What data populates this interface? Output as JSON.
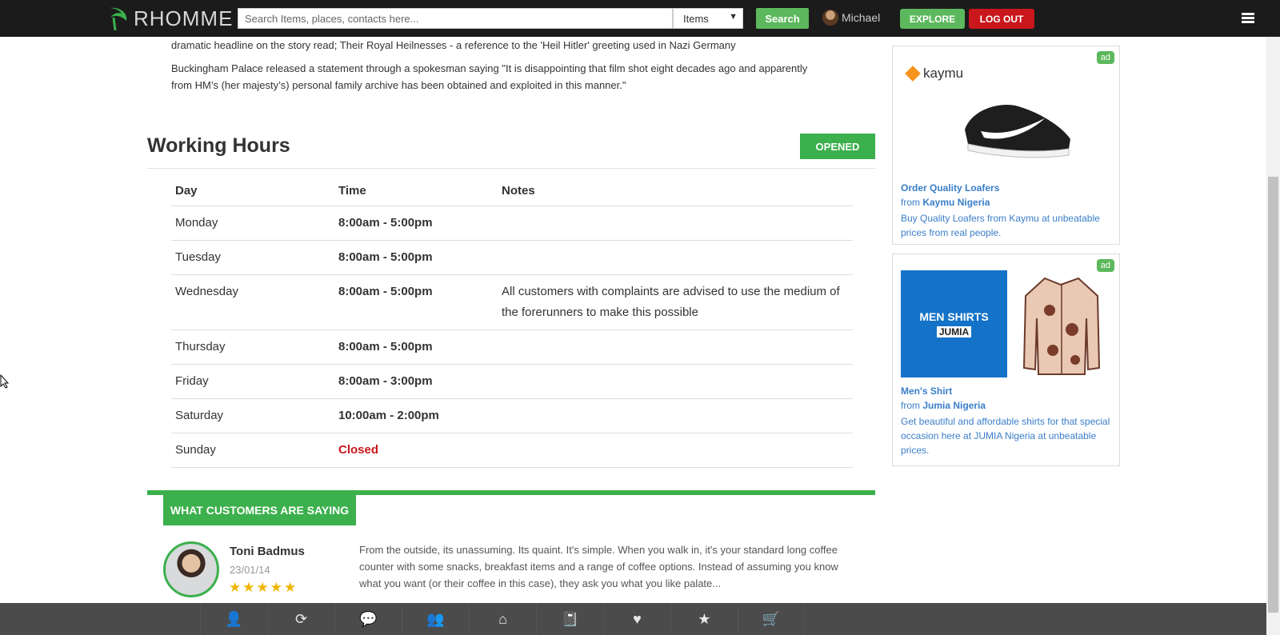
{
  "header": {
    "logo_text": "RHOMME",
    "search_placeholder": "Search Items, places, contacts here...",
    "search_category": "Items",
    "search_button": "Search",
    "user_name": "Michael",
    "explore_button": "EXPLORE",
    "logout_button": "LOG OUT"
  },
  "article": {
    "paragraphs": [
      "dramatic headline on the story read; Their Royal Heilnesses - a reference to the 'Heil Hitler' greeting used in Nazi Germany",
      "Buckingham Palace released a statement through a spokesman saying \"It is disappointing that film shot eight decades ago and apparently from HM’s (her majesty’s) personal family archive has been obtained and exploited in this manner.\""
    ]
  },
  "working_hours": {
    "title": "Working Hours",
    "status": "OPENED",
    "columns": [
      "Day",
      "Time",
      "Notes"
    ],
    "rows": [
      {
        "day": "Monday",
        "time": "8:00am - 5:00pm",
        "notes": ""
      },
      {
        "day": "Tuesday",
        "time": "8:00am - 5:00pm",
        "notes": ""
      },
      {
        "day": "Wednesday",
        "time": "8:00am - 5:00pm",
        "notes": "All customers with complaints are advised to use the medium of the forerunners to make this possible"
      },
      {
        "day": "Thursday",
        "time": "8:00am - 5:00pm",
        "notes": ""
      },
      {
        "day": "Friday",
        "time": "8:00am - 3:00pm",
        "notes": ""
      },
      {
        "day": "Saturday",
        "time": "10:00am - 2:00pm",
        "notes": ""
      },
      {
        "day": "Sunday",
        "time": "Closed",
        "notes": ""
      }
    ]
  },
  "customers": {
    "heading": "WHAT CUSTOMERS ARE SAYING",
    "review": {
      "name": "Toni Badmus",
      "date": "23/01/14",
      "rating": 4.5,
      "stars": "★★★★★",
      "text": "From the outside, its unassuming. Its quaint. It's simple. When you walk in, it's your standard long coffee counter with some snacks, breakfast items and a range of coffee options. Instead of assuming you know what you want (or their coffee in this case), they ask you what you like palate..."
    }
  },
  "ads": [
    {
      "badge": "ad",
      "brand_logo": "kaymu",
      "title": "Order Quality Loafers",
      "from_label": "from",
      "from": "Kaymu Nigeria",
      "description": "Buy Quality Loafers from Kaymu at unbeatable prices from real people."
    },
    {
      "badge": "ad",
      "banner_heading": "MEN SHIRTS",
      "banner_brand": "JUMIA",
      "title": "Men's Shirt",
      "from_label": "from",
      "from": "Jumia Nigeria",
      "description": "Get beautiful and affordable shirts for that special occasion here at JUMIA Nigeria at unbeatable prices."
    }
  ],
  "bottom_toolbar": {
    "icons": [
      "user-icon",
      "refresh-icon",
      "chat-icon",
      "group-icon",
      "home-icon",
      "book-icon",
      "heart-icon",
      "star-icon",
      "cart-icon"
    ],
    "glyphs": [
      "👤",
      "⟳",
      "💬",
      "👥",
      "⌂",
      "📓",
      "♥",
      "★",
      "🛒"
    ]
  },
  "colors": {
    "brand_green": "#3bb04c",
    "danger_red": "#c9171c",
    "link_blue": "#3a7ec9",
    "topbar": "#1b1b1b"
  }
}
